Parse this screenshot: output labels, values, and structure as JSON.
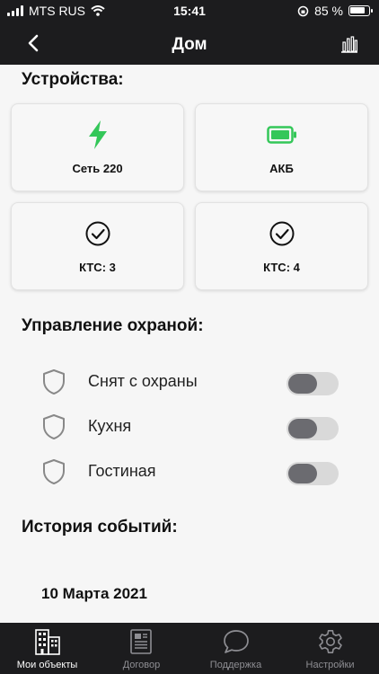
{
  "status_bar": {
    "carrier": "MTS RUS",
    "time": "15:41",
    "battery": "85 %",
    "battery_level": 0.85
  },
  "header": {
    "title": "Дом",
    "back_icon": "chevron-left-icon",
    "stats_icon": "bar-chart-icon"
  },
  "devices": {
    "title": "Устройства:",
    "cards": [
      {
        "label": "Сеть 220",
        "icon": "lightning-icon"
      },
      {
        "label": "АКБ",
        "icon": "battery-icon"
      },
      {
        "label": "КТС: 3",
        "icon": "check-circle-icon"
      },
      {
        "label": "КТС: 4",
        "icon": "check-circle-icon"
      }
    ]
  },
  "security": {
    "title": "Управление охраной:",
    "items": [
      {
        "label": "Снят с охраны",
        "enabled": false
      },
      {
        "label": "Кухня",
        "enabled": false
      },
      {
        "label": "Гостиная",
        "enabled": false
      }
    ]
  },
  "history": {
    "title": "История событий:",
    "date": "10 Марта 2021"
  },
  "tabbar": {
    "tabs": [
      {
        "label": "Мои объекты",
        "icon": "building-icon",
        "active": true
      },
      {
        "label": "Договор",
        "icon": "document-icon",
        "active": false
      },
      {
        "label": "Поддержка",
        "icon": "chat-bubble-icon",
        "active": false
      },
      {
        "label": "Настройки",
        "icon": "gear-icon",
        "active": false
      }
    ]
  },
  "colors": {
    "accent_green": "#34c759",
    "bar_bg": "#1c1c1e",
    "toggle_track": "#d9d9d9",
    "toggle_knob": "#6b6b70"
  }
}
